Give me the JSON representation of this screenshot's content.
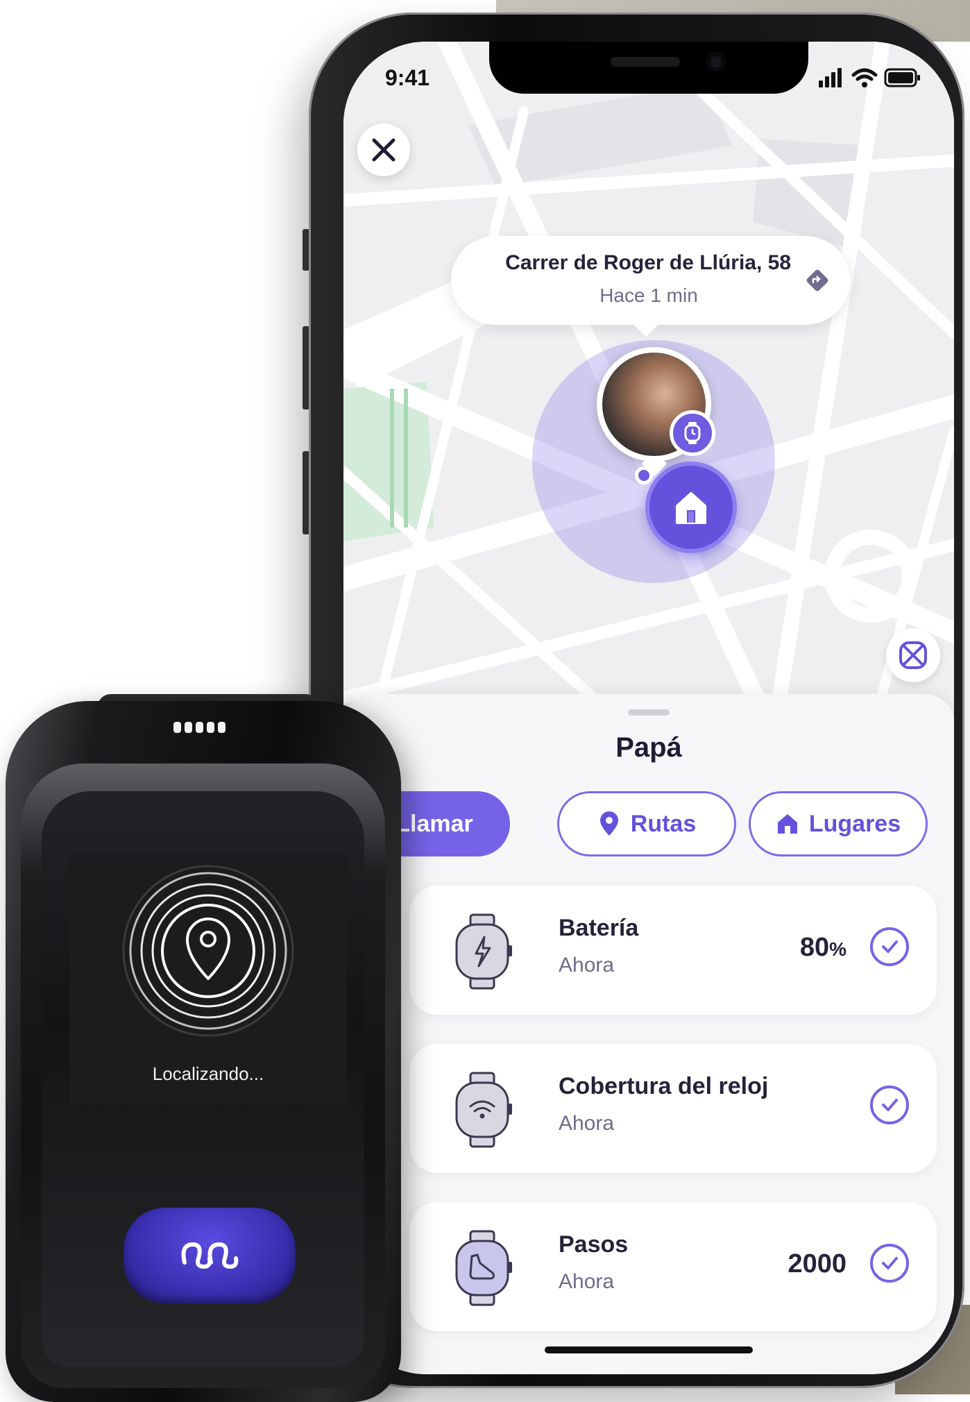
{
  "status_bar": {
    "time": "9:41"
  },
  "map": {
    "location_callout": {
      "address": "Carrer de Roger de Llúria, 58",
      "updated": "Hace 1 min"
    }
  },
  "sheet": {
    "title": "Papá",
    "actions": [
      {
        "label": "Llamar",
        "icon": "phone-icon"
      },
      {
        "label": "Rutas",
        "icon": "location-pin-icon"
      },
      {
        "label": "Lugares",
        "icon": "home-icon"
      }
    ],
    "status_cards": [
      {
        "label": "Batería",
        "time": "Ahora",
        "value": "80",
        "unit": "%",
        "icon": "battery-watch-icon"
      },
      {
        "label": "Cobertura del reloj",
        "time": "Ahora",
        "value": "",
        "unit": "",
        "icon": "wifi-watch-icon"
      },
      {
        "label": "Pasos",
        "time": "Ahora",
        "value": "2000",
        "unit": "",
        "icon": "steps-watch-icon"
      }
    ]
  },
  "watch": {
    "status": "Localizando..."
  },
  "colors": {
    "accent": "#7463e6",
    "accent_dark": "#6452dc",
    "text_primary": "#24233a",
    "text_secondary": "#6e6c88"
  }
}
